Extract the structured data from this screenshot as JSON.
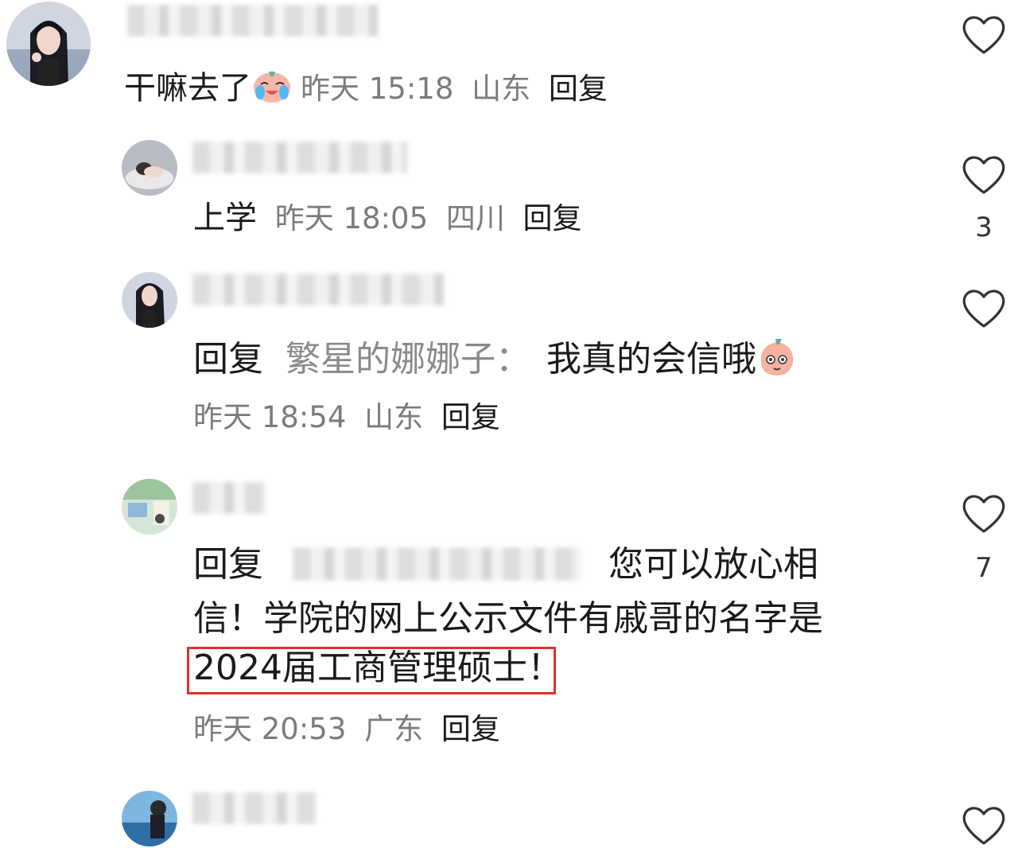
{
  "colors": {
    "highlight_box": "#e0302a",
    "meta_text": "#7b7b7b",
    "reply_name": "#8a8a8a"
  },
  "comments": [
    {
      "text": "干嘛去了",
      "emoji": "crying-laughing-emoji",
      "time": "昨天 15:18",
      "location": "山东",
      "reply_label": "回复",
      "like_count": ""
    },
    {
      "text": "上学",
      "time": "昨天 18:05",
      "location": "四川",
      "reply_label": "回复",
      "like_count": "3"
    },
    {
      "prefix": "回复",
      "reply_to": "繁星的娜娜子：",
      "text": "我真的会信哦",
      "emoji": "peach-face-emoji",
      "time": "昨天 18:54",
      "location": "山东",
      "reply_label": "回复",
      "like_count": ""
    },
    {
      "prefix": "回复",
      "text_line1": "您可以放心相",
      "text_line2": "信！学院的网上公示文件有戚哥的名字是",
      "highlighted": "2024届工商管理硕士",
      "tail": "！",
      "time": "昨天 20:53",
      "location": "广东",
      "reply_label": "回复",
      "like_count": "7"
    }
  ]
}
